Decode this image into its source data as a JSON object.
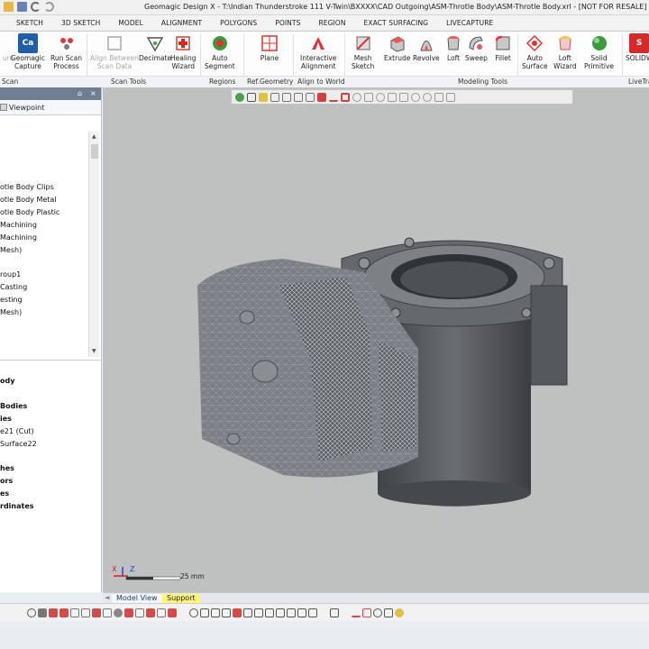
{
  "window": {
    "title": "Geomagic Design X - T:\\Indian Thunderstroke 111 V-Twin\\BXXXX\\CAD Outgoing\\ASM-Throtle Body\\ASM-Throtle Body.xrl - [NOT FOR RESALE]"
  },
  "ribbon_tabs": [
    "SKETCH",
    "3D SKETCH",
    "MODEL",
    "ALIGNMENT",
    "POLYGONS",
    "POINTS",
    "REGION",
    "EXACT SURFACING",
    "LIVECAPTURE"
  ],
  "ribbon": {
    "buttons": [
      {
        "l1": "ure",
        "l2": "",
        "enabled": false
      },
      {
        "l1": "Geomagic",
        "l2": "Capture",
        "enabled": true
      },
      {
        "l1": "Run Scan",
        "l2": "Process",
        "enabled": true
      },
      {
        "l1": "Align Between",
        "l2": "Scan Data",
        "enabled": false
      },
      {
        "l1": "Decimate",
        "l2": "",
        "enabled": true
      },
      {
        "l1": "Healing",
        "l2": "Wizard",
        "enabled": true
      },
      {
        "l1": "Auto",
        "l2": "Segment",
        "enabled": true
      },
      {
        "l1": "Plane",
        "l2": "",
        "enabled": true
      },
      {
        "l1": "Interactive",
        "l2": "Alignment",
        "enabled": true
      },
      {
        "l1": "Mesh",
        "l2": "Sketch",
        "enabled": true
      },
      {
        "l1": "Extrude",
        "l2": "",
        "enabled": true
      },
      {
        "l1": "Revolve",
        "l2": "",
        "enabled": true
      },
      {
        "l1": "Loft",
        "l2": "",
        "enabled": true
      },
      {
        "l1": "Sweep",
        "l2": "",
        "enabled": true
      },
      {
        "l1": "Fillet",
        "l2": "",
        "enabled": true
      },
      {
        "l1": "Auto",
        "l2": "Surface",
        "enabled": true
      },
      {
        "l1": "Loft",
        "l2": "Wizard",
        "enabled": true
      },
      {
        "l1": "Solid",
        "l2": "Primitive",
        "enabled": true
      },
      {
        "l1": "SOLIDW",
        "l2": "",
        "enabled": true
      }
    ],
    "groups": [
      "Scan",
      "Scan Tools",
      "Regions",
      "Ref.Geometry",
      "Align to World",
      "Modeling Tools",
      "LiveTra"
    ]
  },
  "left_panel": {
    "pin": "⌂",
    "close": "×",
    "tab": "Viewpoint",
    "tree_top": [
      "otle Body Clips",
      "otle Body Metal",
      "otle Body Plastic",
      "Machining",
      "Machining",
      "Mesh)",
      "roup1",
      "Casting",
      "esting",
      "Mesh)"
    ],
    "tree_bottom": [
      {
        "text": "ody",
        "bold": true
      },
      {
        "text": "Bodies",
        "bold": true
      },
      {
        "text": "ies",
        "bold": true
      },
      {
        "text": "e21 (Cut)",
        "bold": false
      },
      {
        "text": "Surface22",
        "bold": false
      },
      {
        "text": "hes",
        "bold": true
      },
      {
        "text": "ors",
        "bold": true
      },
      {
        "text": "es",
        "bold": true
      },
      {
        "text": "rdinates",
        "bold": true
      }
    ]
  },
  "viewport": {
    "scale_label": "25 mm",
    "axis_x": "X",
    "axis_z": "Z",
    "model_color": "#53565b"
  },
  "bottom_tabs": {
    "model_view": "Model View",
    "support": "Support"
  },
  "colors": {
    "accent": "#1e6fc0",
    "viewport_bg": "#bfc1c1",
    "panel_header": "#6e7f93"
  }
}
